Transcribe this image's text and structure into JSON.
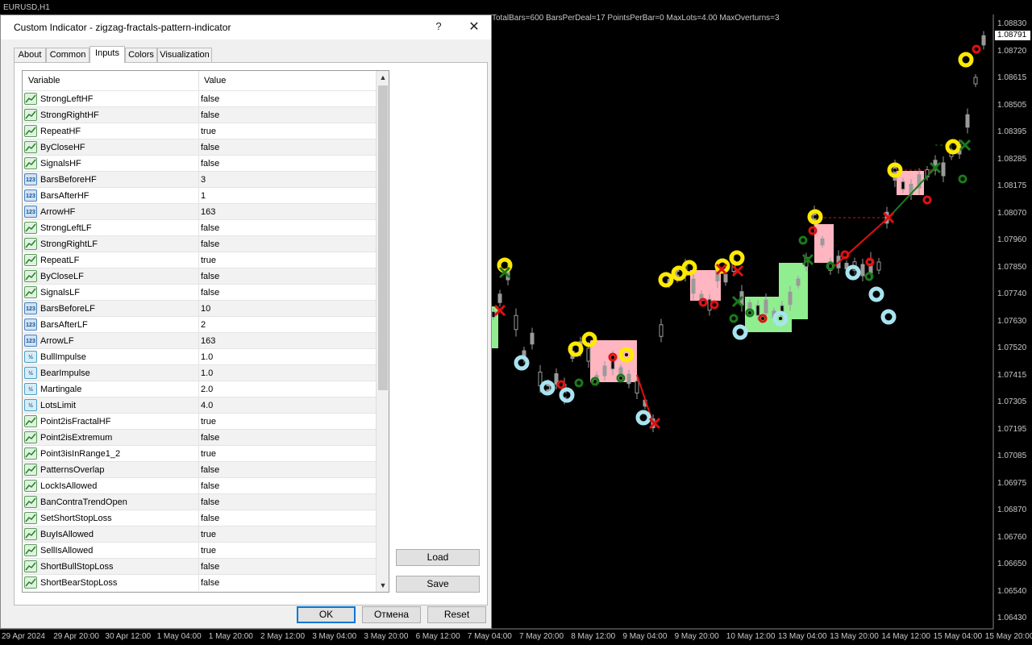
{
  "chart": {
    "title": "EURUSD,H1",
    "info": "TotalBars=600 BarsPerDeal=17 PointsPerBar=0 MaxLots=4.00 MaxOverturns=3",
    "current_price": "1.08791",
    "prices": [
      "1.08830",
      "1.08720",
      "1.08615",
      "1.08505",
      "1.08395",
      "1.08285",
      "1.08175",
      "1.08070",
      "1.07960",
      "1.07850",
      "1.07740",
      "1.07630",
      "1.07520",
      "1.07415",
      "1.07305",
      "1.07195",
      "1.07085",
      "1.06975",
      "1.06870",
      "1.06760",
      "1.06650",
      "1.06540",
      "1.06430"
    ],
    "times": [
      "29 Apr 2024",
      "29 Apr 20:00",
      "30 Apr 12:00",
      "1 May 04:00",
      "1 May 20:00",
      "2 May 12:00",
      "3 May 04:00",
      "3 May 20:00",
      "6 May 12:00",
      "7 May 04:00",
      "7 May 20:00",
      "8 May 12:00",
      "9 May 04:00",
      "9 May 20:00",
      "10 May 12:00",
      "13 May 04:00",
      "13 May 20:00",
      "14 May 12:00",
      "15 May 04:00",
      "15 May 20:00"
    ],
    "colors": {
      "up_bar": "#9a9a9a",
      "pink_box": "#ffb6c1",
      "green_box": "#90ee90",
      "yellow_marker": "#ffea00",
      "cyan_marker": "#a8e4f0",
      "red_marker": "#e01010",
      "green_marker": "#1a7a1a"
    }
  },
  "dialog": {
    "title": "Custom Indicator - zigzag-fractals-pattern-indicator",
    "help": "?",
    "close": "✕",
    "tabs": [
      "About",
      "Common",
      "Inputs",
      "Colors",
      "Visualization"
    ],
    "active_tab": "Inputs",
    "columns": {
      "variable": "Variable",
      "value": "Value"
    },
    "rows": [
      {
        "name": "StrongLeftHF",
        "value": "false",
        "type": "bool"
      },
      {
        "name": "StrongRightHF",
        "value": "false",
        "type": "bool"
      },
      {
        "name": "RepeatHF",
        "value": "true",
        "type": "bool"
      },
      {
        "name": "ByCloseHF",
        "value": "false",
        "type": "bool"
      },
      {
        "name": "SignalsHF",
        "value": "false",
        "type": "bool"
      },
      {
        "name": "BarsBeforeHF",
        "value": "3",
        "type": "int"
      },
      {
        "name": "BarsAfterHF",
        "value": "1",
        "type": "int"
      },
      {
        "name": "ArrowHF",
        "value": "163",
        "type": "int"
      },
      {
        "name": "StrongLeftLF",
        "value": "false",
        "type": "bool"
      },
      {
        "name": "StrongRightLF",
        "value": "false",
        "type": "bool"
      },
      {
        "name": "RepeatLF",
        "value": "true",
        "type": "bool"
      },
      {
        "name": "ByCloseLF",
        "value": "false",
        "type": "bool"
      },
      {
        "name": "SignalsLF",
        "value": "false",
        "type": "bool"
      },
      {
        "name": "BarsBeforeLF",
        "value": "10",
        "type": "int"
      },
      {
        "name": "BarsAfterLF",
        "value": "2",
        "type": "int"
      },
      {
        "name": "ArrowLF",
        "value": "163",
        "type": "int"
      },
      {
        "name": "BullImpulse",
        "value": "1.0",
        "type": "dbl"
      },
      {
        "name": "BearImpulse",
        "value": "1.0",
        "type": "dbl"
      },
      {
        "name": "Martingale",
        "value": "2.0",
        "type": "dbl"
      },
      {
        "name": "LotsLimit",
        "value": "4.0",
        "type": "dbl"
      },
      {
        "name": "Point2isFractalHF",
        "value": "true",
        "type": "bool"
      },
      {
        "name": "Point2isExtremum",
        "value": "false",
        "type": "bool"
      },
      {
        "name": "Point3isInRange1_2",
        "value": "true",
        "type": "bool"
      },
      {
        "name": "PatternsOverlap",
        "value": "false",
        "type": "bool"
      },
      {
        "name": "LockIsAllowed",
        "value": "false",
        "type": "bool"
      },
      {
        "name": "BanContraTrendOpen",
        "value": "false",
        "type": "bool"
      },
      {
        "name": "SetShortStopLoss",
        "value": "false",
        "type": "bool"
      },
      {
        "name": "BuyIsAllowed",
        "value": "true",
        "type": "bool"
      },
      {
        "name": "SellIsAllowed",
        "value": "true",
        "type": "bool"
      },
      {
        "name": "ShortBullStopLoss",
        "value": "false",
        "type": "bool"
      },
      {
        "name": "ShortBearStopLoss",
        "value": "false",
        "type": "bool"
      }
    ],
    "icon_labels": {
      "bool": "",
      "int": "123",
      "dbl": "½"
    },
    "buttons": {
      "load": "Load",
      "save": "Save",
      "ok": "OK",
      "cancel": "Отмена",
      "reset": "Reset"
    }
  }
}
